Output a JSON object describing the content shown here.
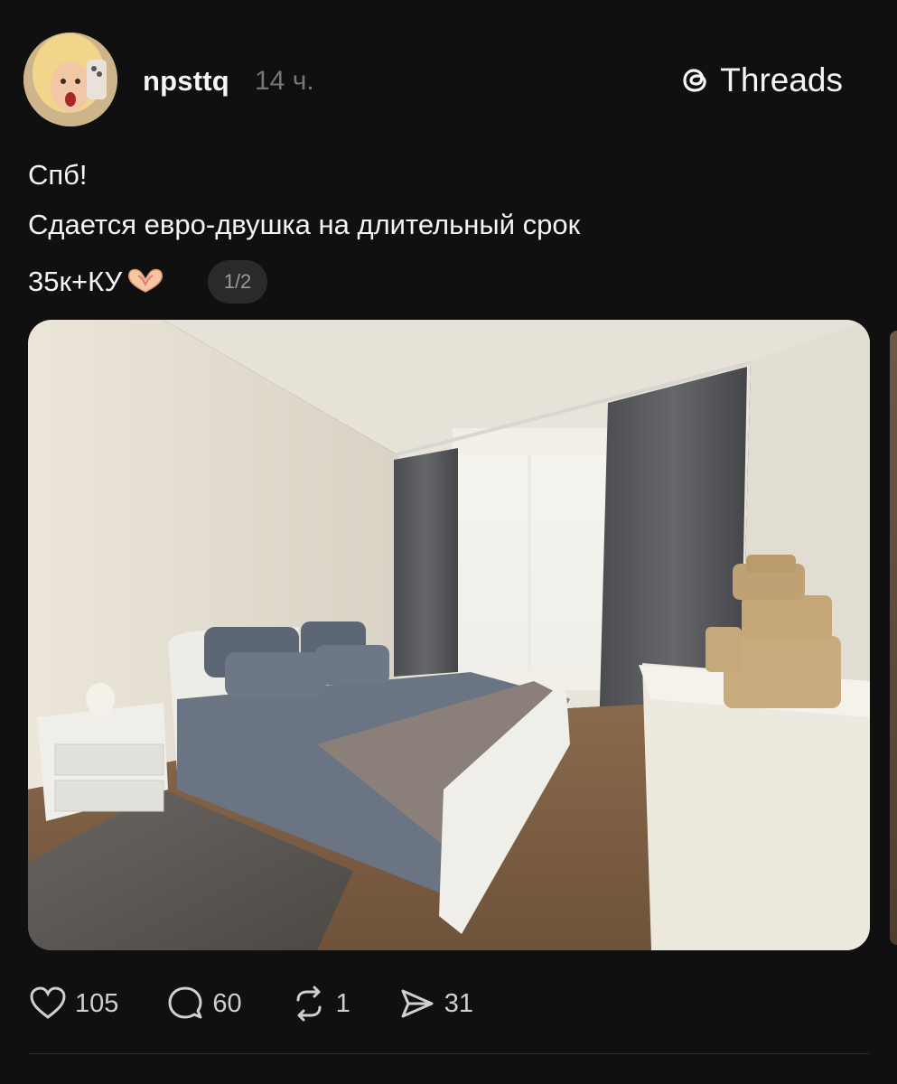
{
  "post": {
    "username": "npsttq",
    "time": "14 ч.",
    "brand": "Threads",
    "caption_line1": "Спб!",
    "caption_line2": "Сдается евро-двушка на длительный срок",
    "caption_line3": "35к+КУ",
    "emoji_name": "heart-hands-emoji",
    "media_counter": "1/2"
  },
  "stats": {
    "likes": "105",
    "comments": "60",
    "reposts": "1",
    "shares": "31"
  },
  "colors": {
    "background": "#101010",
    "text": "#f3f5f7",
    "muted": "#777777",
    "pill": "#2a2a2a"
  }
}
